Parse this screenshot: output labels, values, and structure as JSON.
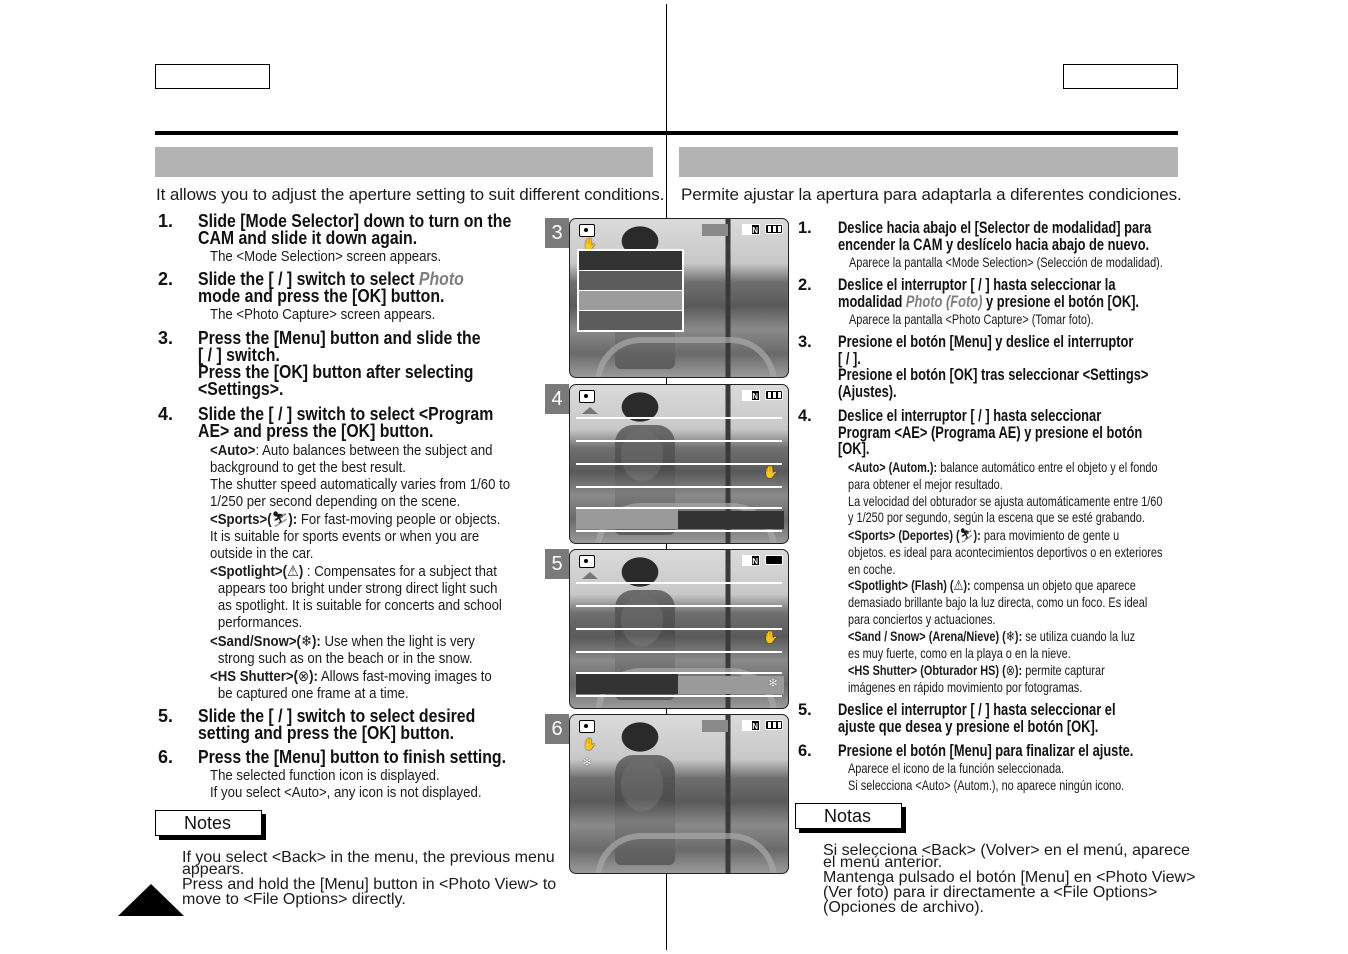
{
  "english": {
    "intro": "It allows you to adjust the aperture setting to suit different conditions.",
    "steps": [
      {
        "num": "1.",
        "lines": [
          "Slide [Mode Selector] down to turn on the",
          "CAM and slide it down again."
        ],
        "sub": [
          "The <Mode Selection> screen appears."
        ]
      },
      {
        "num": "2.",
        "lines_pre": "Slide the [    /    ] switch to select ",
        "lines_italic": "Photo",
        "line2": "mode and press the [OK] button.",
        "sub": [
          "The <Photo Capture> screen appears."
        ]
      },
      {
        "num": "3.",
        "lines": [
          "Press the [Menu] button and slide the",
          "[    /    ] switch.",
          "Press the [OK] button after selecting",
          "<Settings>."
        ]
      },
      {
        "num": "4.",
        "lines": [
          "Slide the [    /    ] switch to select <Program",
          "AE> and press the [OK] button."
        ]
      },
      {
        "num": "5.",
        "lines": [
          "Slide the [    /    ] switch to select desired",
          "setting and press the [OK] button."
        ]
      },
      {
        "num": "6.",
        "lines": [
          "Press the [Menu] button to finish setting."
        ],
        "sub": [
          "The selected function icon is displayed.",
          "If you select <Auto>, any icon is not displayed."
        ]
      }
    ],
    "modes": [
      {
        "label": "<Auto>",
        "text": ": Auto balances between the subject and",
        "more": [
          "background to get the best result.",
          "The shutter speed automatically varies from 1/60 to",
          "1/250 per second depending on the scene."
        ]
      },
      {
        "label": "<Sports>(",
        "icon": "⛷",
        "label_end": "):",
        "text": " For fast-moving people or objects.",
        "more": [
          "It is suitable for sports events or when you are",
          "outside in the car."
        ]
      },
      {
        "label": "<Spotlight>(",
        "icon": "⚠",
        "label_end": ")",
        "text": " : Compensates for a subject that",
        "more": [
          "appears too bright under strong direct light such",
          "as spotlight. It is suitable for concerts and school",
          "performances."
        ]
      },
      {
        "label": "<Sand/Snow>(",
        "icon": "❄",
        "label_end": "):",
        "text": " Use when the light is very",
        "more": [
          "strong such as on the beach or in the snow."
        ]
      },
      {
        "label": "<HS Shutter>(",
        "icon": "⊗",
        "label_end": "):",
        "text": " Allows fast-moving images to",
        "more": [
          "be captured one frame at a time."
        ]
      }
    ],
    "notes_title": "Notes",
    "notes": [
      "If you select <Back> in the menu, the previous menu",
      "appears.",
      "Press and hold the [Menu] button in <Photo View> to",
      "move to <File Options> directly."
    ]
  },
  "spanish": {
    "intro": "Permite ajustar la apertura para adaptarla a diferentes condiciones.",
    "steps": [
      {
        "num": "1.",
        "lines": [
          "Deslice hacia abajo el [Selector de modalidad] para",
          "encender la CAM y deslícelo hacia abajo de nuevo."
        ],
        "sub": [
          "Aparece la pantalla <Mode Selection> (Selección de modalidad)."
        ]
      },
      {
        "num": "2.",
        "line1": "Deslice el interruptor [    /    ] hasta seleccionar la",
        "line2_pre": "modalidad ",
        "line2_italic": "Photo (Foto)",
        "line2_post": " y presione el botón [OK].",
        "sub": [
          "Aparece la pantalla <Photo Capture> (Tomar foto)."
        ]
      },
      {
        "num": "3.",
        "lines": [
          "Presione el botón [Menu] y deslice el interruptor",
          "[    /    ].",
          "Presione el botón [OK] tras seleccionar <Settings>",
          "(Ajustes)."
        ]
      },
      {
        "num": "4.",
        "lines": [
          "Deslice el interruptor [    /    ] hasta seleccionar",
          "Program <AE> (Programa AE) y presione el botón",
          "[OK]."
        ]
      },
      {
        "num": "5.",
        "lines": [
          "Deslice el interruptor [    /    ] hasta seleccionar el",
          "ajuste que desea y presione el botón [OK]."
        ]
      },
      {
        "num": "6.",
        "lines": [
          "Presione el botón [Menu] para finalizar el ajuste."
        ],
        "sub": [
          "Aparece el icono de la función seleccionada.",
          "Si selecciona <Auto> (Autom.), no aparece ningún icono."
        ]
      }
    ],
    "modes": [
      {
        "label": "<Auto> (Autom.):",
        "text": " balance automático entre el objeto y el fondo",
        "more": [
          "para obtener el mejor resultado.",
          "La velocidad del obturador se ajusta automáticamente entre 1/60",
          "y 1/250 por segundo, según la escena que se esté grabando."
        ]
      },
      {
        "label": "<Sports> (Deportes) (",
        "icon": "⛷",
        "label_end": "):",
        "text": " para movimiento de gente u",
        "more": [
          "objetos. es ideal para acontecimientos deportivos o en exteriores",
          "en coche."
        ]
      },
      {
        "label": "<Spotlight> (Flash) (",
        "icon": "⚠",
        "label_end": "):",
        "text": " compensa un objeto que aparece",
        "more": [
          "demasiado brillante bajo la luz directa, como un foco. Es ideal",
          "para conciertos y actuaciones."
        ]
      },
      {
        "label": "<Sand / Snow> (Arena/Nieve) (",
        "icon": "❄",
        "label_end": "):",
        "text": " se utiliza cuando la luz",
        "more": [
          "es muy fuerte, como en la playa o en la nieve."
        ]
      },
      {
        "label": "<HS Shutter> (Obturador HS) (",
        "icon": "⊗",
        "label_end": "):",
        "text": " permite capturar",
        "more": [
          "imágenes en rápido movimiento por fotogramas."
        ]
      }
    ],
    "notes_title": "Notas",
    "notes": [
      "Si selecciona <Back> (Volver> en el menú, aparece",
      "el menú anterior.",
      "Mantenga pulsado el botón [Menu] en <Photo View>",
      "(Ver foto) para ir directamente a <File Options>",
      "(Opciones de archivo)."
    ]
  },
  "screens": [
    {
      "badge": "3",
      "quality": "N",
      "icons": [
        "camera-icon",
        "hand-stabilizer-icon"
      ]
    },
    {
      "badge": "4",
      "quality": "N",
      "icons": [
        "camera-icon",
        "hand-stabilizer-icon"
      ]
    },
    {
      "badge": "5",
      "quality": "N",
      "icons": [
        "camera-icon",
        "hand-stabilizer-icon",
        "snowflake-icon"
      ]
    },
    {
      "badge": "6",
      "quality": "N",
      "icons": [
        "camera-icon",
        "hand-stabilizer-icon",
        "snowflake-icon"
      ]
    }
  ],
  "glyphs": {
    "hand": "✋",
    "snow": "❄"
  },
  "colors": {
    "section_bar": "#b3b3b3",
    "badge": "#7a7a7a",
    "italic_accent": "#7d7d7d"
  }
}
